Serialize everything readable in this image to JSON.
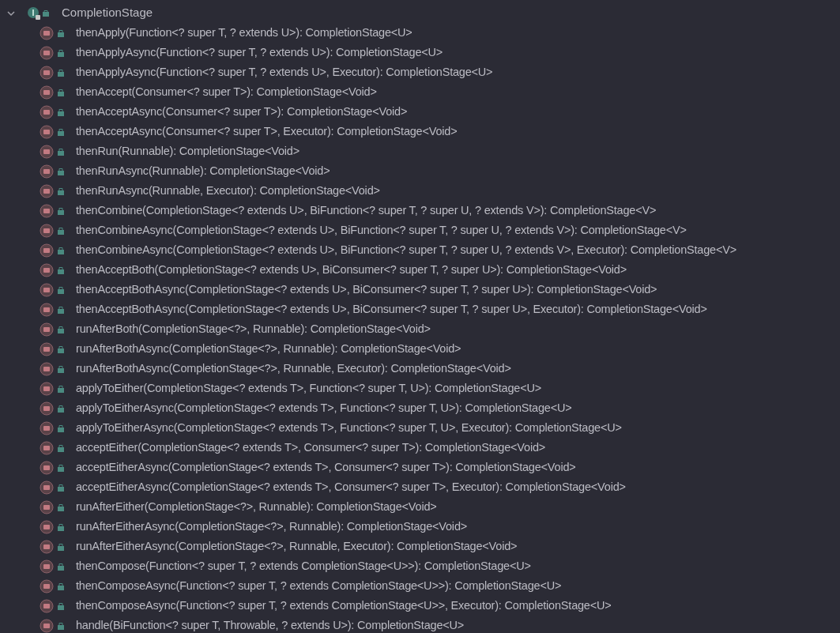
{
  "tree": {
    "label": "CompletionStage",
    "expanded": true,
    "children": [
      {
        "label": "thenApply(Function<? super T, ? extends U>): CompletionStage<U>"
      },
      {
        "label": "thenApplyAsync(Function<? super T, ? extends U>): CompletionStage<U>"
      },
      {
        "label": "thenApplyAsync(Function<? super T, ? extends U>, Executor): CompletionStage<U>"
      },
      {
        "label": "thenAccept(Consumer<? super T>): CompletionStage<Void>"
      },
      {
        "label": "thenAcceptAsync(Consumer<? super T>): CompletionStage<Void>"
      },
      {
        "label": "thenAcceptAsync(Consumer<? super T>, Executor): CompletionStage<Void>"
      },
      {
        "label": "thenRun(Runnable): CompletionStage<Void>"
      },
      {
        "label": "thenRunAsync(Runnable): CompletionStage<Void>"
      },
      {
        "label": "thenRunAsync(Runnable, Executor): CompletionStage<Void>"
      },
      {
        "label": "thenCombine(CompletionStage<? extends U>, BiFunction<? super T, ? super U, ? extends V>): CompletionStage<V>"
      },
      {
        "label": "thenCombineAsync(CompletionStage<? extends U>, BiFunction<? super T, ? super U, ? extends V>): CompletionStage<V>"
      },
      {
        "label": "thenCombineAsync(CompletionStage<? extends U>, BiFunction<? super T, ? super U, ? extends V>, Executor): CompletionStage<V>"
      },
      {
        "label": "thenAcceptBoth(CompletionStage<? extends U>, BiConsumer<? super T, ? super U>): CompletionStage<Void>"
      },
      {
        "label": "thenAcceptBothAsync(CompletionStage<? extends U>, BiConsumer<? super T, ? super U>): CompletionStage<Void>"
      },
      {
        "label": "thenAcceptBothAsync(CompletionStage<? extends U>, BiConsumer<? super T, ? super U>, Executor): CompletionStage<Void>"
      },
      {
        "label": "runAfterBoth(CompletionStage<?>, Runnable): CompletionStage<Void>"
      },
      {
        "label": "runAfterBothAsync(CompletionStage<?>, Runnable): CompletionStage<Void>"
      },
      {
        "label": "runAfterBothAsync(CompletionStage<?>, Runnable, Executor): CompletionStage<Void>"
      },
      {
        "label": "applyToEither(CompletionStage<? extends T>, Function<? super T, U>): CompletionStage<U>"
      },
      {
        "label": "applyToEitherAsync(CompletionStage<? extends T>, Function<? super T, U>): CompletionStage<U>"
      },
      {
        "label": "applyToEitherAsync(CompletionStage<? extends T>, Function<? super T, U>, Executor): CompletionStage<U>"
      },
      {
        "label": "acceptEither(CompletionStage<? extends T>, Consumer<? super T>): CompletionStage<Void>"
      },
      {
        "label": "acceptEitherAsync(CompletionStage<? extends T>, Consumer<? super T>): CompletionStage<Void>"
      },
      {
        "label": "acceptEitherAsync(CompletionStage<? extends T>, Consumer<? super T>, Executor): CompletionStage<Void>"
      },
      {
        "label": "runAfterEither(CompletionStage<?>, Runnable): CompletionStage<Void>"
      },
      {
        "label": "runAfterEitherAsync(CompletionStage<?>, Runnable): CompletionStage<Void>"
      },
      {
        "label": "runAfterEitherAsync(CompletionStage<?>, Runnable, Executor): CompletionStage<Void>"
      },
      {
        "label": "thenCompose(Function<? super T, ? extends CompletionStage<U>>): CompletionStage<U>"
      },
      {
        "label": "thenComposeAsync(Function<? super T, ? extends CompletionStage<U>>): CompletionStage<U>"
      },
      {
        "label": "thenComposeAsync(Function<? super T, ? extends CompletionStage<U>>, Executor): CompletionStage<U>"
      },
      {
        "label": "handle(BiFunction<? super T, Throwable, ? extends U>): CompletionStage<U>"
      }
    ]
  }
}
